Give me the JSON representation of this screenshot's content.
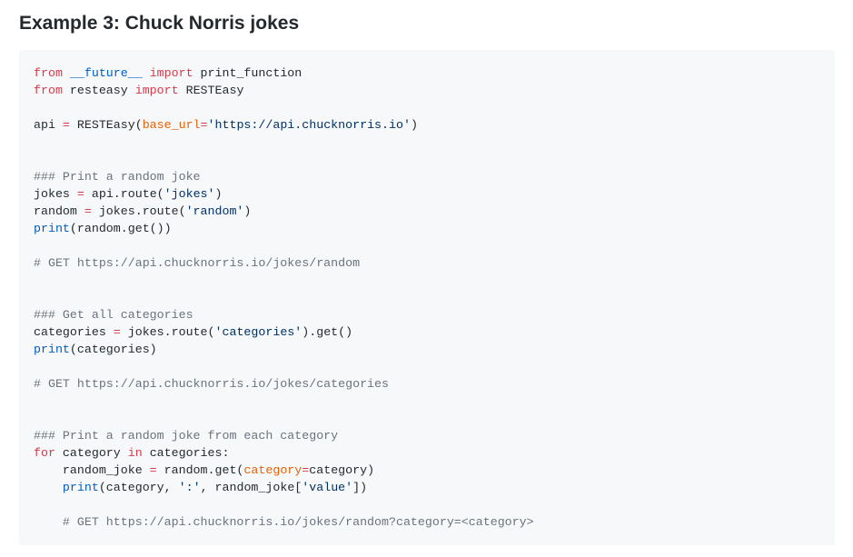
{
  "heading": "Example 3: Chuck Norris jokes",
  "code": {
    "language": "python",
    "lines": [
      [
        {
          "t": "kw",
          "v": "from"
        },
        {
          "t": "plain",
          "v": " "
        },
        {
          "t": "mod",
          "v": "__future__"
        },
        {
          "t": "plain",
          "v": " "
        },
        {
          "t": "kw",
          "v": "import"
        },
        {
          "t": "plain",
          "v": " print_function"
        }
      ],
      [
        {
          "t": "kw",
          "v": "from"
        },
        {
          "t": "plain",
          "v": " resteasy "
        },
        {
          "t": "kw",
          "v": "import"
        },
        {
          "t": "plain",
          "v": " RESTEasy"
        }
      ],
      [],
      [
        {
          "t": "plain",
          "v": "api "
        },
        {
          "t": "op",
          "v": "="
        },
        {
          "t": "plain",
          "v": " RESTEasy("
        },
        {
          "t": "param",
          "v": "base_url"
        },
        {
          "t": "op",
          "v": "="
        },
        {
          "t": "str",
          "v": "'https://api.chucknorris.io'"
        },
        {
          "t": "plain",
          "v": ")"
        }
      ],
      [],
      [],
      [
        {
          "t": "comment",
          "v": "### Print a random joke"
        }
      ],
      [
        {
          "t": "plain",
          "v": "jokes "
        },
        {
          "t": "op",
          "v": "="
        },
        {
          "t": "plain",
          "v": " api.route("
        },
        {
          "t": "str",
          "v": "'jokes'"
        },
        {
          "t": "plain",
          "v": ")"
        }
      ],
      [
        {
          "t": "plain",
          "v": "random "
        },
        {
          "t": "op",
          "v": "="
        },
        {
          "t": "plain",
          "v": " jokes.route("
        },
        {
          "t": "str",
          "v": "'random'"
        },
        {
          "t": "plain",
          "v": ")"
        }
      ],
      [
        {
          "t": "builtin",
          "v": "print"
        },
        {
          "t": "plain",
          "v": "(random.get())"
        }
      ],
      [],
      [
        {
          "t": "comment",
          "v": "# GET https://api.chucknorris.io/jokes/random"
        }
      ],
      [],
      [],
      [
        {
          "t": "comment",
          "v": "### Get all categories"
        }
      ],
      [
        {
          "t": "plain",
          "v": "categories "
        },
        {
          "t": "op",
          "v": "="
        },
        {
          "t": "plain",
          "v": " jokes.route("
        },
        {
          "t": "str",
          "v": "'categories'"
        },
        {
          "t": "plain",
          "v": ").get()"
        }
      ],
      [
        {
          "t": "builtin",
          "v": "print"
        },
        {
          "t": "plain",
          "v": "(categories)"
        }
      ],
      [],
      [
        {
          "t": "comment",
          "v": "# GET https://api.chucknorris.io/jokes/categories"
        }
      ],
      [],
      [],
      [
        {
          "t": "comment",
          "v": "### Print a random joke from each category"
        }
      ],
      [
        {
          "t": "kw",
          "v": "for"
        },
        {
          "t": "plain",
          "v": " category "
        },
        {
          "t": "kw",
          "v": "in"
        },
        {
          "t": "plain",
          "v": " categories:"
        }
      ],
      [
        {
          "t": "plain",
          "v": "    random_joke "
        },
        {
          "t": "op",
          "v": "="
        },
        {
          "t": "plain",
          "v": " random.get("
        },
        {
          "t": "param",
          "v": "category"
        },
        {
          "t": "op",
          "v": "="
        },
        {
          "t": "plain",
          "v": "category)"
        }
      ],
      [
        {
          "t": "plain",
          "v": "    "
        },
        {
          "t": "builtin",
          "v": "print"
        },
        {
          "t": "plain",
          "v": "(category, "
        },
        {
          "t": "str",
          "v": "':'"
        },
        {
          "t": "plain",
          "v": ", random_joke["
        },
        {
          "t": "str",
          "v": "'value'"
        },
        {
          "t": "plain",
          "v": "])"
        }
      ],
      [],
      [
        {
          "t": "plain",
          "v": "    "
        },
        {
          "t": "comment",
          "v": "# GET https://api.chucknorris.io/jokes/random?category=<category>"
        }
      ]
    ]
  },
  "colors": {
    "keyword": "#d73a49",
    "module": "#005cc5",
    "string": "#032f62",
    "parameter": "#e36209",
    "comment": "#6a737d",
    "builtin": "#005cc5",
    "text": "#24292e",
    "code_background": "#f6f8fa"
  }
}
